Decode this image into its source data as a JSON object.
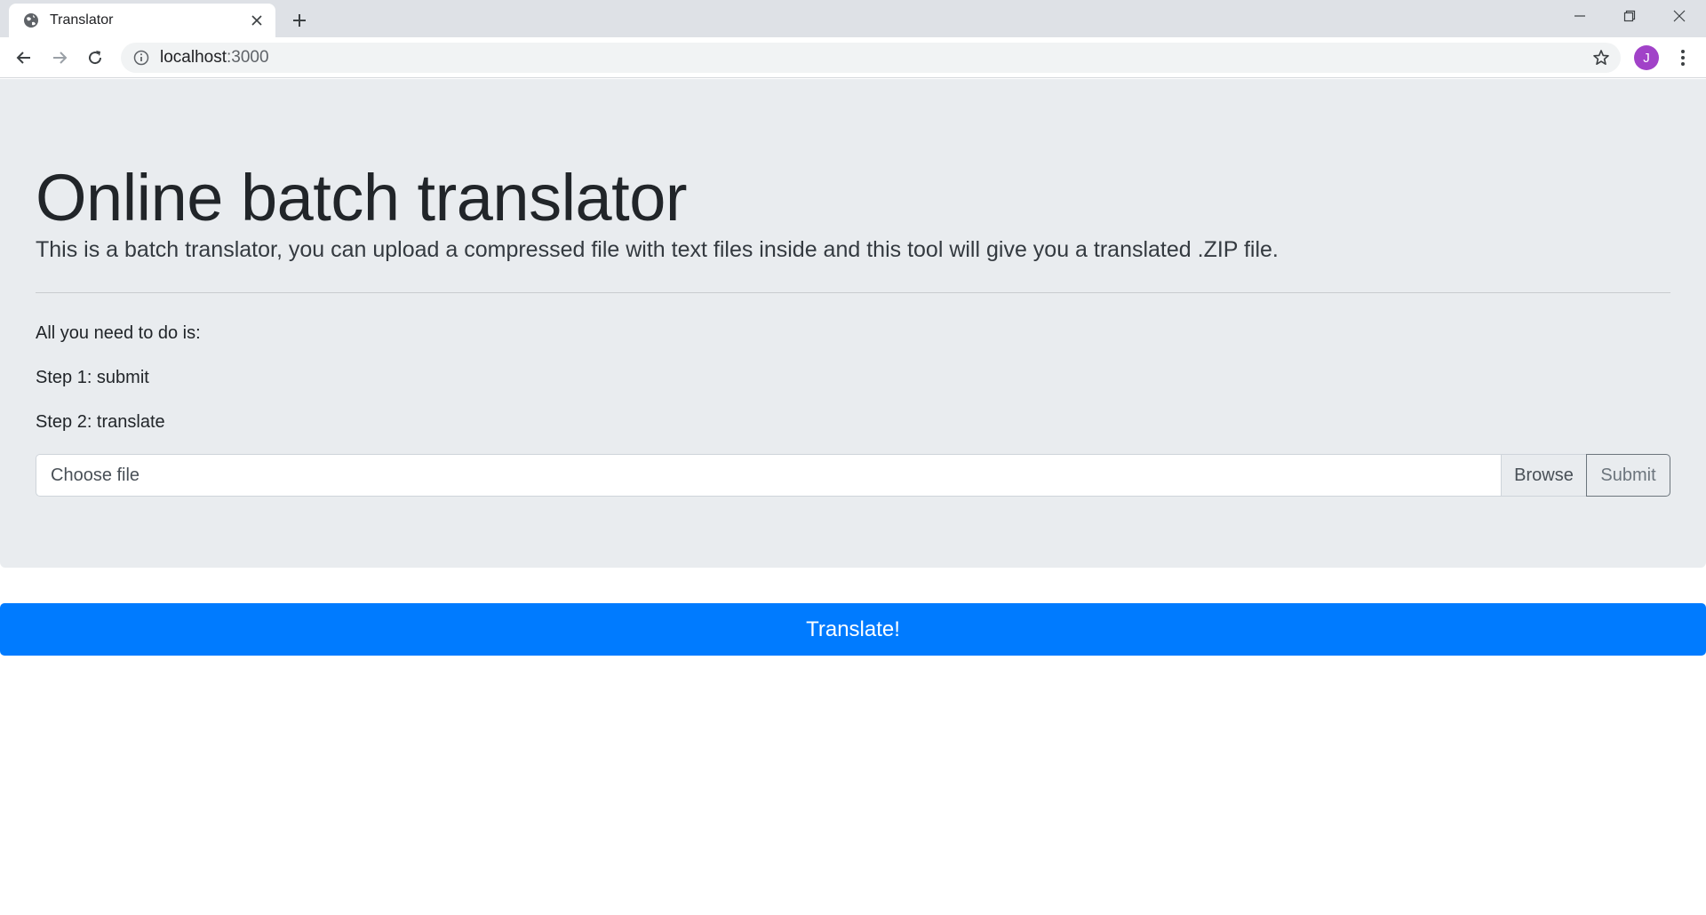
{
  "browser": {
    "tab_title": "Translator",
    "url_host": "localhost",
    "url_port": ":3000",
    "profile_initial": "J"
  },
  "page": {
    "title": "Online batch translator",
    "lead": "This is a batch translator, you can upload a compressed file with text files inside and this tool will give you a translated .ZIP file.",
    "intro": "All you need to do is:",
    "step1": "Step 1: submit",
    "step2": "Step 2: translate",
    "file_placeholder": "Choose file",
    "browse_label": "Browse",
    "submit_label": "Submit",
    "translate_label": "Translate!"
  },
  "colors": {
    "accent": "#007bff",
    "jumbotron_bg": "#e9ecef",
    "avatar_bg": "#a142c8"
  },
  "icons": {
    "tab_favicon": "globe-icon",
    "tab_close": "close-icon",
    "new_tab": "plus-icon",
    "back": "arrow-left-icon",
    "forward": "arrow-right-icon",
    "reload": "reload-icon",
    "site_info": "info-icon",
    "bookmark": "star-icon",
    "menu": "kebab-menu-icon"
  }
}
